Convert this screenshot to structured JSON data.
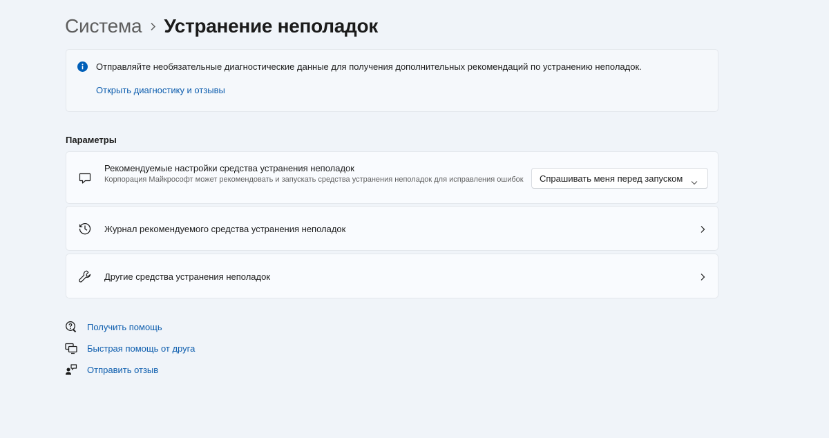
{
  "breadcrumb": {
    "parent": "Система",
    "current": "Устранение неполадок"
  },
  "info_bar": {
    "icon": "info-icon",
    "text": "Отправляйте необязательные диагностические данные для получения дополнительных рекомендаций по устранению неполадок.",
    "link": "Открыть диагностику и отзывы"
  },
  "section": {
    "label": "Параметры"
  },
  "settings": [
    {
      "icon": "chat-bubble-icon",
      "title": "Рекомендуемые настройки средства устранения неполадок",
      "description": "Корпорация Майкрософт может рекомендовать и запускать средства устранения неполадок для исправления ошибок",
      "dropdown_value": "Спрашивать меня перед запуском"
    },
    {
      "icon": "history-icon",
      "title": "Журнал рекомендуемого средства устранения неполадок"
    },
    {
      "icon": "wrench-icon",
      "title": "Другие средства устранения неполадок"
    }
  ],
  "help_links": [
    {
      "icon": "get-help-icon",
      "label": "Получить помощь"
    },
    {
      "icon": "quick-assist-icon",
      "label": "Быстрая помощь от друга"
    },
    {
      "icon": "feedback-icon",
      "label": "Отправить отзыв"
    }
  ],
  "colors": {
    "background": "#f0f4f9",
    "card": "#f9fbfe",
    "accent": "#005fb8",
    "link": "#0b5cad"
  }
}
